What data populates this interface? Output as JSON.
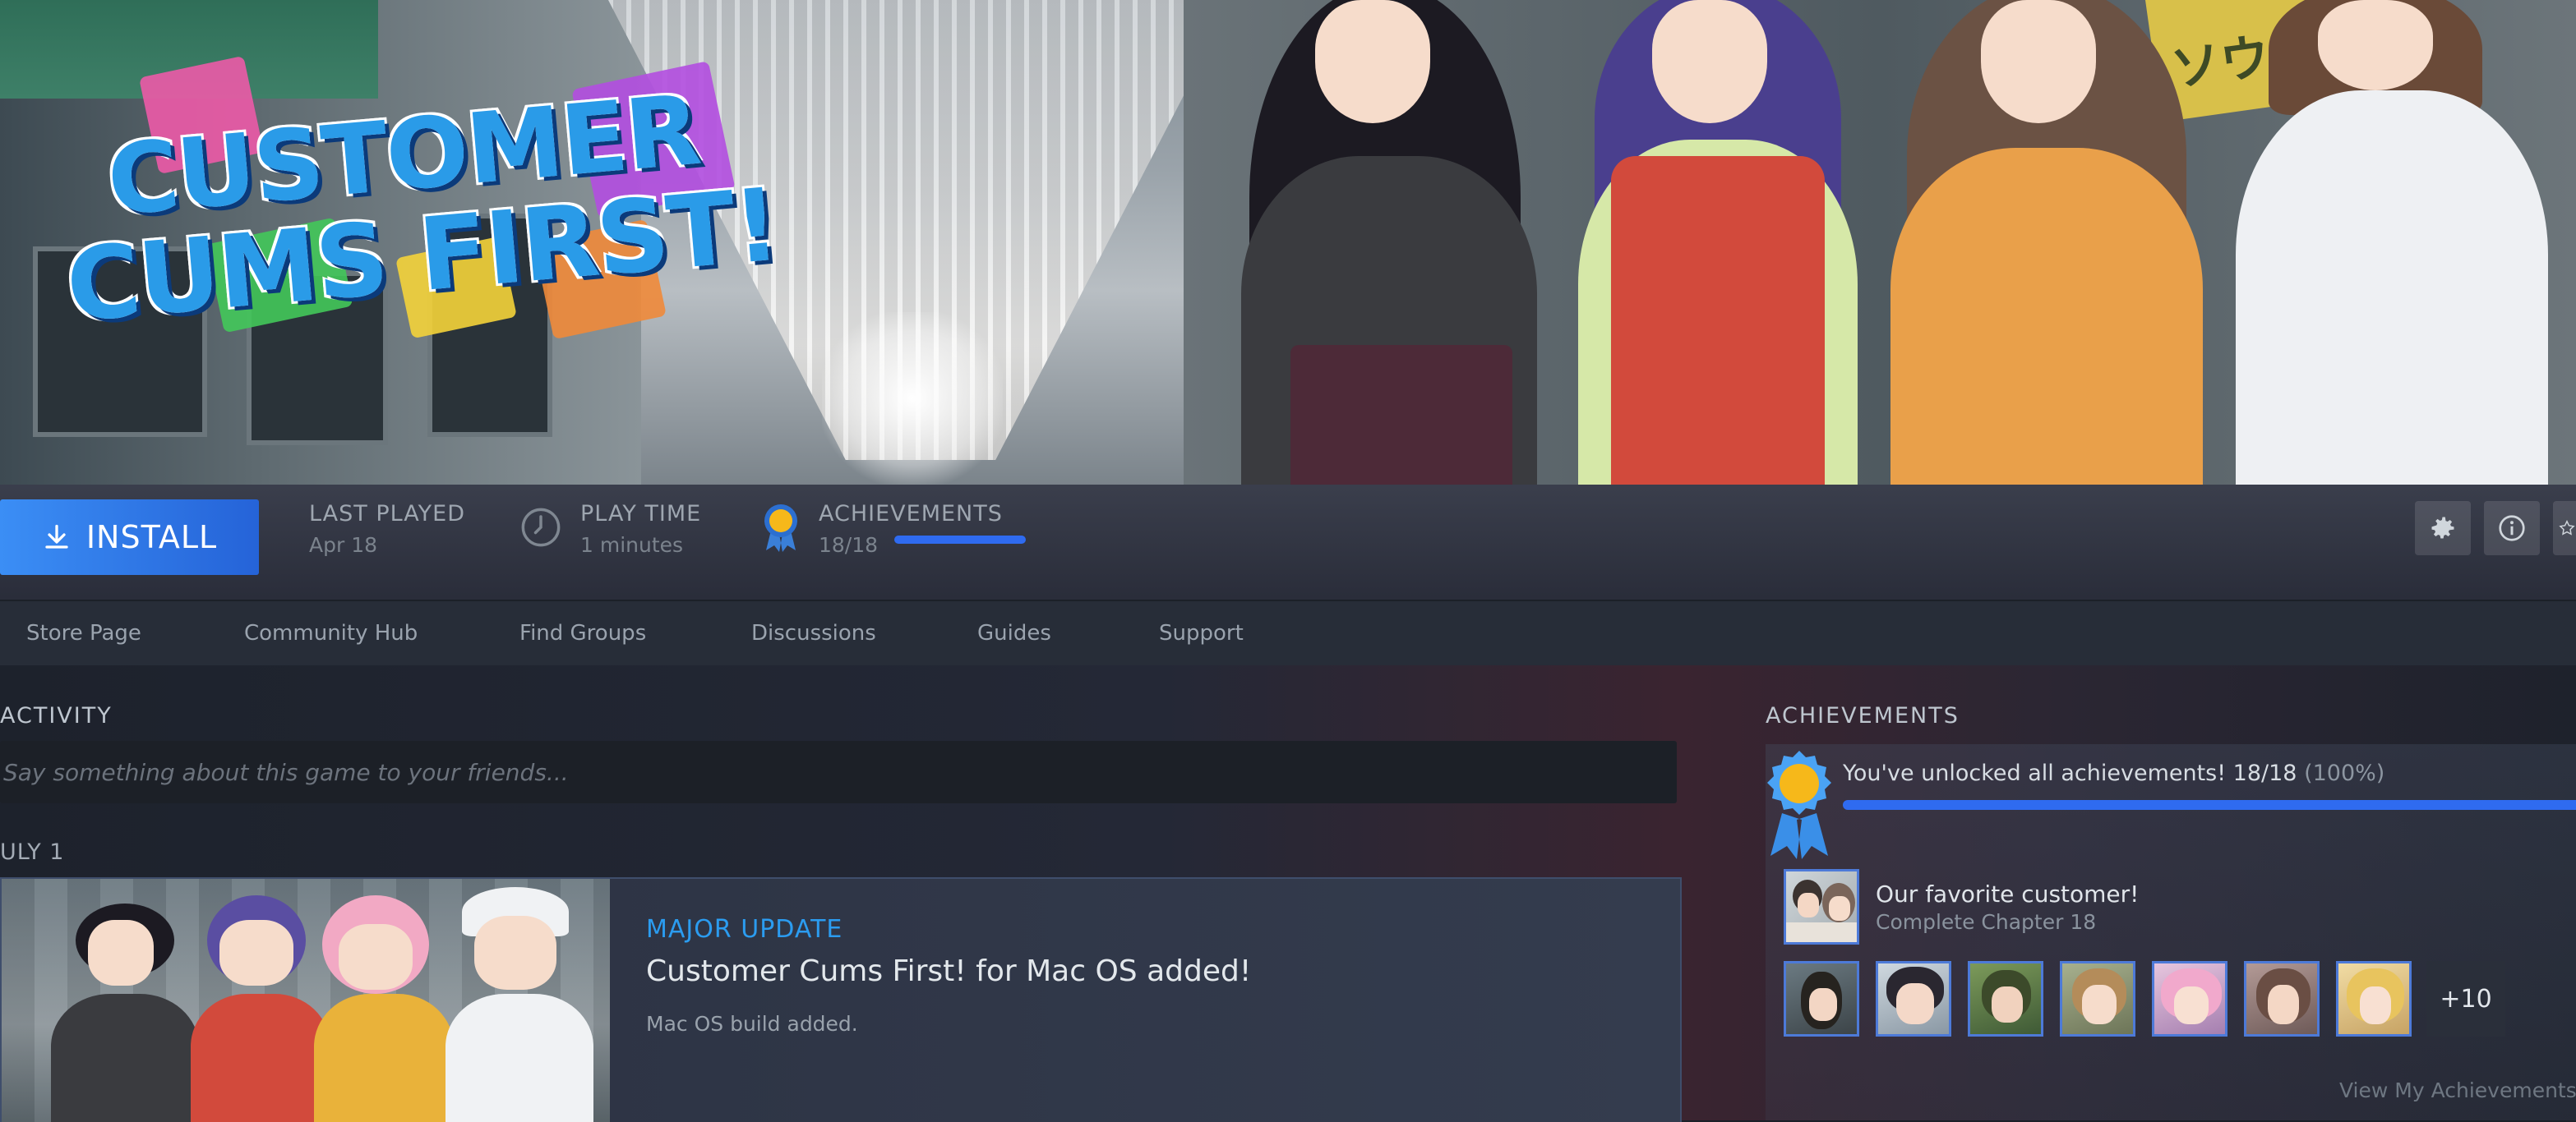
{
  "hero": {
    "logo_line1": "CUSTOMER",
    "logo_line2": "CUMS FIRST!",
    "sign_text": "ソウカ"
  },
  "actionbar": {
    "install_label": "INSTALL",
    "install_icon": "download-icon",
    "last_played": {
      "label": "LAST PLAYED",
      "value": "Apr 18"
    },
    "play_time": {
      "label": "PLAY TIME",
      "value": "1 minutes",
      "icon": "clock-icon"
    },
    "achievements": {
      "label": "ACHIEVEMENTS",
      "value": "18/18",
      "progress": 1.0,
      "icon": "medal-icon"
    },
    "icon_buttons": [
      "gear-icon",
      "info-icon",
      "star-icon"
    ]
  },
  "nav": {
    "items": [
      "Store Page",
      "Community Hub",
      "Find Groups",
      "Discussions",
      "Guides",
      "Support"
    ]
  },
  "activity": {
    "title": "ACTIVITY",
    "placeholder": "Say something about this game to your friends...",
    "date": "ULY 1",
    "post": {
      "type": "MAJOR UPDATE",
      "title": "Customer Cums First! for Mac OS added!",
      "description": "Mac OS build added."
    }
  },
  "achievements_panel": {
    "title": "ACHIEVEMENTS",
    "summary": "You've unlocked all achievements! 18/18",
    "summary_pct": "(100%)",
    "progress": 1.0,
    "featured": {
      "title": "Our favorite customer!",
      "description": "Complete Chapter 18"
    },
    "more_count": "+10",
    "view_link": "View My Achievements"
  },
  "colors": {
    "accent_blue": "#2f6bf0",
    "install_blue": "#3b8ef5",
    "update_blue": "#2b9cf0",
    "background": "#1b2028"
  }
}
